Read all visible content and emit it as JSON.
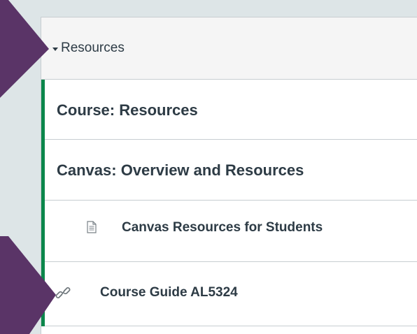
{
  "module": {
    "title": "Resources",
    "caret_icon": "caret-down-icon"
  },
  "items": [
    {
      "type": "text-header",
      "label": "Course: Resources"
    },
    {
      "type": "text-header",
      "label": "Canvas: Overview and Resources"
    },
    {
      "type": "page",
      "label": "Canvas Resources for Students",
      "icon": "page-icon"
    },
    {
      "type": "external-link",
      "label": "Course Guide AL5324",
      "icon": "link-icon"
    }
  ],
  "colors": {
    "accent": "#0b874b",
    "pointer_arrow": "#5a3467",
    "text": "#2d3b45",
    "header_bg": "#f5f5f5",
    "page_bg": "#dde5e7"
  }
}
